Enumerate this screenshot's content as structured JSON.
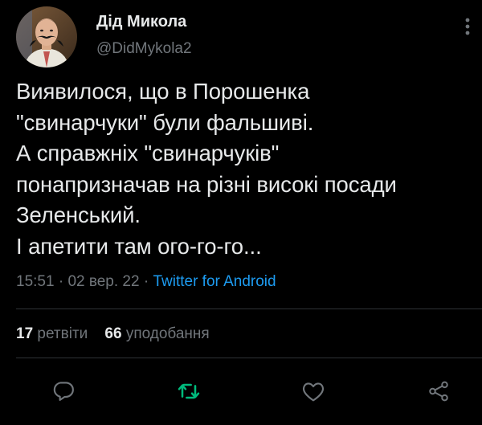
{
  "author": {
    "display_name": "Дід Микола",
    "handle": "@DidMykola2",
    "avatar_icon": "avatar-man-mustache"
  },
  "tweet": {
    "text": "Виявилося, що в Порошенка\n\"свинарчуки\" були фальшиві.\nА справжніх \"свинарчуків\"\nпонапризначав на різні високі посади\nЗеленський.\nІ апетити там ого-го-го...",
    "time": "15:51",
    "separator": "·",
    "date": "02 вер. 22",
    "source": "Twitter for Android"
  },
  "stats": {
    "retweets_count": "17",
    "retweets_label": "ретвіти",
    "likes_count": "66",
    "likes_label": "уподобання"
  },
  "actions": {
    "reply_icon": "speech-bubble-icon",
    "retweet_icon": "retweet-arrows-icon",
    "like_icon": "heart-outline-icon",
    "share_icon": "share-nodes-icon"
  },
  "colors": {
    "background": "#000000",
    "text": "#e7e9ea",
    "muted": "#71767b",
    "accent": "#1d9bf0",
    "retweet_active": "#00ba7c",
    "divider": "#2f3336"
  }
}
